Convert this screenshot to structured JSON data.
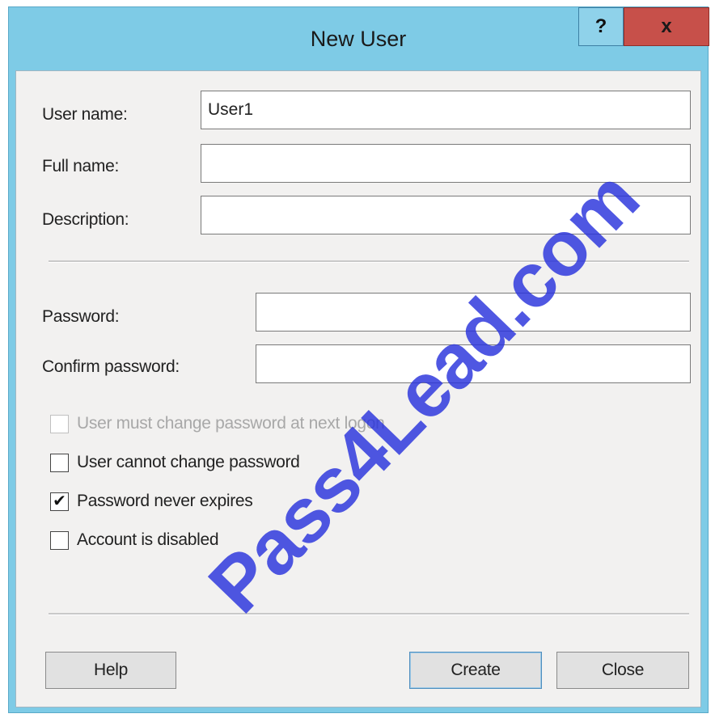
{
  "window": {
    "title": "New User",
    "help_glyph": "?",
    "close_glyph": "x"
  },
  "form": {
    "username_label": "User name:",
    "username_value": "User1",
    "fullname_label": "Full name:",
    "fullname_value": "",
    "description_label": "Description:",
    "description_value": "",
    "password_label": "Password:",
    "password_value": "",
    "confirm_label": "Confirm password:",
    "confirm_value": ""
  },
  "options": [
    {
      "label": "User must change password at next logon",
      "checked": false,
      "disabled": true
    },
    {
      "label": "User cannot change password",
      "checked": false,
      "disabled": false
    },
    {
      "label": "Password never expires",
      "checked": true,
      "disabled": false
    },
    {
      "label": "Account is disabled",
      "checked": false,
      "disabled": false
    }
  ],
  "checkmark_glyph": "✔",
  "buttons": {
    "help": "Help",
    "create": "Create",
    "close": "Close"
  },
  "watermark": "Pass4Lead.com"
}
